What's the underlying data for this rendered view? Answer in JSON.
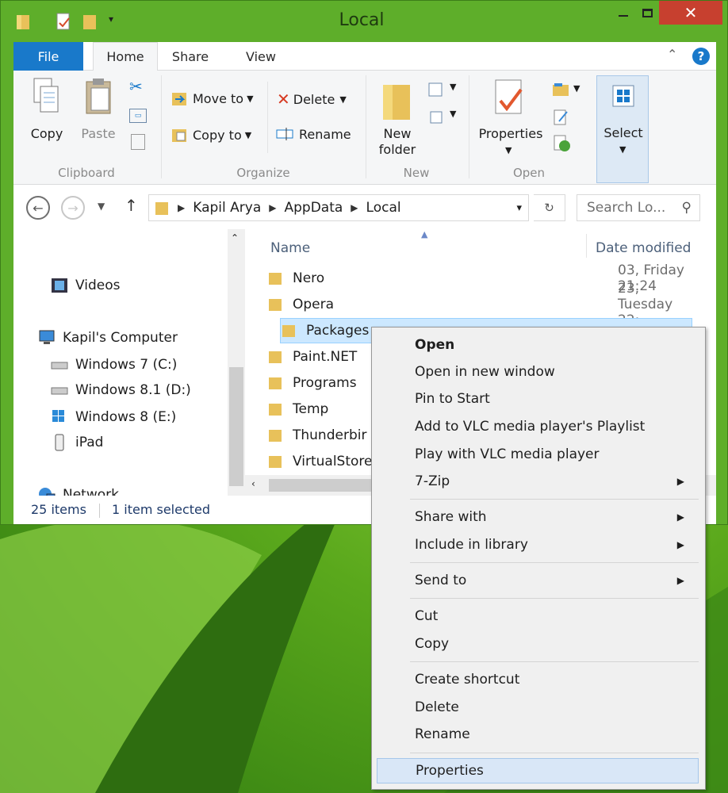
{
  "window": {
    "title": "Local"
  },
  "ribbon": {
    "tabs": [
      "File",
      "Home",
      "Share",
      "View"
    ],
    "clipboard": {
      "copy": "Copy",
      "paste": "Paste",
      "label": "Clipboard"
    },
    "organize": {
      "move_to": "Move to",
      "copy_to": "Copy to",
      "delete": "Delete",
      "rename": "Rename",
      "label": "Organize"
    },
    "new": {
      "new_folder_line1": "New",
      "new_folder_line2": "folder",
      "label": "New"
    },
    "open": {
      "properties": "Properties",
      "label": "Open"
    },
    "select": {
      "label": "Select"
    }
  },
  "address": {
    "breadcrumbs": [
      "Kapil Arya",
      "AppData",
      "Local"
    ],
    "search_placeholder": "Search Lo..."
  },
  "nav_pane": {
    "items": [
      {
        "label": "Videos",
        "icon": "videos-icon"
      },
      {
        "label": "Kapil's Computer",
        "icon": "computer-icon"
      },
      {
        "label": "Windows 7 (C:)",
        "icon": "drive-icon"
      },
      {
        "label": "Windows 8.1 (D:)",
        "icon": "drive-icon"
      },
      {
        "label": "Windows 8 (E:)",
        "icon": "windows-drive-icon"
      },
      {
        "label": "iPad",
        "icon": "ipad-icon"
      },
      {
        "label": "Network",
        "icon": "network-icon"
      }
    ]
  },
  "file_list": {
    "columns": {
      "name": "Name",
      "date": "Date modified"
    },
    "files": [
      {
        "name": "Nero",
        "date": "03, Friday 21:24"
      },
      {
        "name": "Opera",
        "date": "23, Tuesday 22:"
      },
      {
        "name": "Packages",
        "date": ""
      },
      {
        "name": "Paint.NET",
        "date": ""
      },
      {
        "name": "Programs",
        "date": ""
      },
      {
        "name": "Temp",
        "date": ""
      },
      {
        "name": "Thunderbir",
        "date": ""
      },
      {
        "name": "VirtualStore",
        "date": ""
      }
    ]
  },
  "status": {
    "count": "25 items",
    "selected": "1 item selected"
  },
  "context_menu": {
    "items": [
      {
        "label": "Open"
      },
      {
        "label": "Open in new window"
      },
      {
        "label": "Pin to Start"
      },
      {
        "label": "Add to VLC media player's Playlist"
      },
      {
        "label": "Play with VLC media player"
      },
      {
        "label": "7-Zip"
      },
      {
        "label": "Share with"
      },
      {
        "label": "Include in library"
      },
      {
        "label": "Send to"
      },
      {
        "label": "Cut"
      },
      {
        "label": "Copy"
      },
      {
        "label": "Create shortcut"
      },
      {
        "label": "Delete"
      },
      {
        "label": "Rename"
      },
      {
        "label": "Properties"
      }
    ]
  },
  "colors": {
    "accent": "#1979ca",
    "close": "#c7402f",
    "selection": "#cce8ff"
  }
}
